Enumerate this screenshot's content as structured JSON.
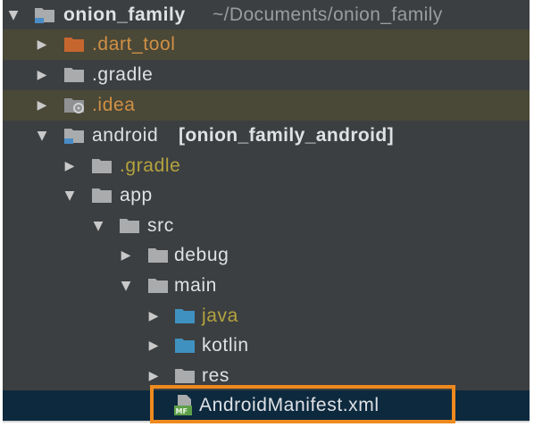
{
  "project_tree": {
    "root": {
      "label": "onion_family",
      "path": "~/Documents/onion_family",
      "expanded_icon": "chevron-down-icon",
      "icon": "module-folder-icon"
    },
    "items": [
      {
        "label": ".dart_tool",
        "state": "collapsed",
        "icon": "excluded-folder-icon"
      },
      {
        "label": ".gradle",
        "state": "collapsed",
        "icon": "folder-icon"
      },
      {
        "label": ".idea",
        "state": "collapsed",
        "icon": "idea-folder-icon"
      },
      {
        "label": "android",
        "suffix": "[onion_family_android]",
        "state": "expanded",
        "icon": "module-folder-icon"
      },
      {
        "label": ".gradle",
        "state": "collapsed",
        "icon": "folder-icon"
      },
      {
        "label": "app",
        "state": "expanded",
        "icon": "folder-icon"
      },
      {
        "label": "src",
        "state": "expanded",
        "icon": "folder-icon"
      },
      {
        "label": "debug",
        "state": "collapsed",
        "icon": "folder-icon"
      },
      {
        "label": "main",
        "state": "expanded",
        "icon": "folder-icon"
      },
      {
        "label": "java",
        "state": "collapsed",
        "icon": "source-folder-icon"
      },
      {
        "label": "kotlin",
        "state": "collapsed",
        "icon": "source-folder-icon"
      },
      {
        "label": "res",
        "state": "collapsed",
        "icon": "folder-icon"
      },
      {
        "label": "AndroidManifest.xml",
        "state": "selected",
        "icon": "manifest-file-icon",
        "badge": "MF"
      }
    ]
  },
  "colors": {
    "background": "#3c3f41",
    "selection": "#0d293e",
    "excluded_row": "#4a4837",
    "highlight_border": "#ee8a1d",
    "folder": "#a9abad",
    "source_folder": "#3f92c0",
    "excluded_folder": "#c6662f",
    "yellow_text": "#b4a33e",
    "orange_text": "#d09045"
  }
}
